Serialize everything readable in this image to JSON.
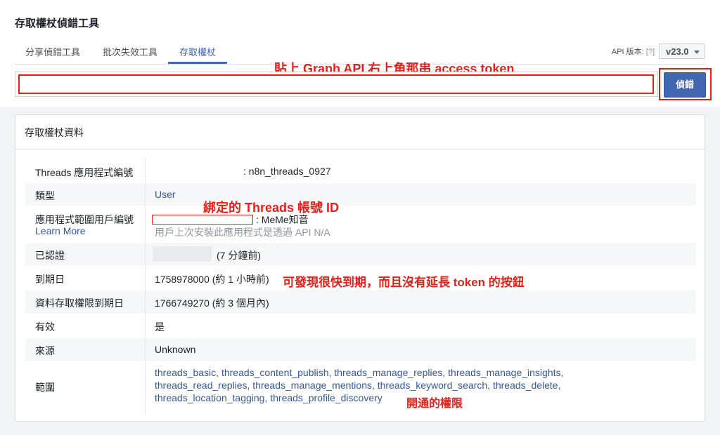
{
  "header": {
    "title": "存取權杖偵錯工具",
    "tabs": [
      {
        "label": "分享偵錯工具",
        "active": false
      },
      {
        "label": "批次失效工具",
        "active": false
      },
      {
        "label": "存取權杖",
        "active": true
      }
    ],
    "api_version_label": "API 版本:",
    "api_version_help": "[?]",
    "api_version": "v23.0"
  },
  "token_input": {
    "value": "",
    "placeholder": ""
  },
  "debug_button": "偵錯",
  "annotations": {
    "paste_token": "貼上 Graph API 右上角那串 access token",
    "bound_account": "綁定的 Threads 帳號 ID",
    "expiry_note": "可發現很快到期，而且沒有延長 token 的按鈕",
    "scopes_note": "開通的權限"
  },
  "card": {
    "title": "存取權杖資料",
    "rows": {
      "app_id": {
        "label": "Threads 應用程式編號",
        "value": ": n8n_threads_0927"
      },
      "type": {
        "label": "類型",
        "value": "User"
      },
      "user_id": {
        "label": "應用程式範圍用戶編號",
        "learn_more": "Learn More",
        "value": ": MeMe知音",
        "note": "用戶上次安裝此應用程式是透過 API N/A"
      },
      "issued": {
        "label": "已認證",
        "value": "(7 分鐘前)"
      },
      "expires": {
        "label": "到期日",
        "value": "1758978000 (約 1 小時前)"
      },
      "data_access_expires": {
        "label": "資料存取權限到期日",
        "value": "1766749270 (約 3 個月內)"
      },
      "valid": {
        "label": "有效",
        "value": "是"
      },
      "origin": {
        "label": "來源",
        "value": "Unknown"
      },
      "scopes": {
        "label": "範圍",
        "lines": [
          "threads_basic, threads_content_publish, threads_manage_replies, threads_manage_insights,",
          "threads_read_replies, threads_manage_mentions, threads_keyword_search, threads_delete,",
          "threads_location_tagging, threads_profile_discovery"
        ]
      }
    }
  },
  "colors": {
    "accent": "#4267b2",
    "annotation": "#e3201b",
    "link": "#365899"
  }
}
